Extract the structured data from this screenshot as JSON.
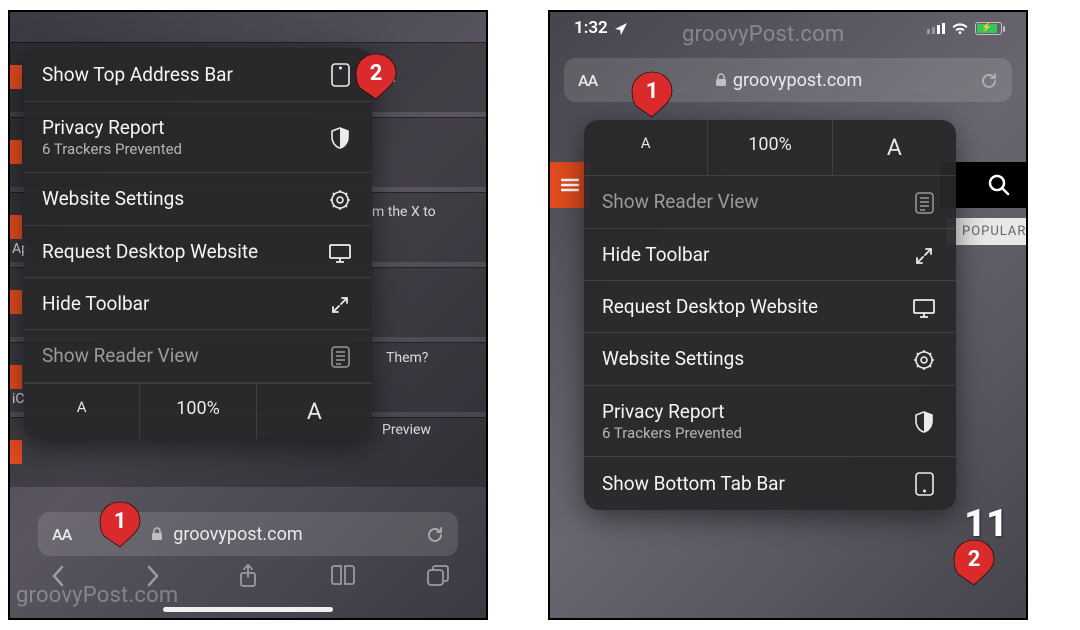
{
  "watermark": "groovyPost.com",
  "left": {
    "bg_rows": [
      {
        "label": ""
      },
      {
        "label": "Ap"
      },
      {
        "label": ""
      },
      {
        "label": "iC"
      },
      {
        "label": ""
      }
    ],
    "bg_right_fragments": [
      "nd",
      "m the X to",
      "Them?",
      "Preview"
    ],
    "menu": [
      {
        "label": "Show Top Address Bar",
        "icon": "address-bar-top-icon"
      },
      {
        "label": "Privacy Report",
        "sub": "6 Trackers Prevented",
        "icon": "shield-icon"
      },
      {
        "label": "Website Settings",
        "icon": "gear-icon"
      },
      {
        "label": "Request Desktop Website",
        "icon": "display-icon"
      },
      {
        "label": "Hide Toolbar",
        "icon": "expand-icon"
      },
      {
        "label": "Show Reader View",
        "icon": "reader-icon",
        "dim": true
      }
    ],
    "zoom": {
      "small": "A",
      "pct": "100%",
      "big": "A"
    },
    "addr": {
      "aa": "AA",
      "url": "groovypost.com"
    },
    "pin1_num": "1",
    "pin2_num": "2"
  },
  "right": {
    "status_time": "1:32",
    "addr": {
      "aa": "AA",
      "url": "groovypost.com"
    },
    "zoom": {
      "small": "A",
      "pct": "100%",
      "big": "A"
    },
    "menu": [
      {
        "label": "Show Reader View",
        "icon": "reader-icon",
        "dim": true
      },
      {
        "label": "Hide Toolbar",
        "icon": "expand-icon"
      },
      {
        "label": "Request Desktop Website",
        "icon": "display-icon"
      },
      {
        "label": "Website Settings",
        "icon": "gear-icon"
      },
      {
        "label": "Privacy Report",
        "sub": "6 Trackers Prevented",
        "icon": "shield-icon"
      },
      {
        "label": "Show Bottom Tab Bar",
        "icon": "address-bar-bottom-icon"
      }
    ],
    "popular": "POPULAR",
    "count_overlay": "11",
    "pin1_num": "1",
    "pin2_num": "2"
  }
}
